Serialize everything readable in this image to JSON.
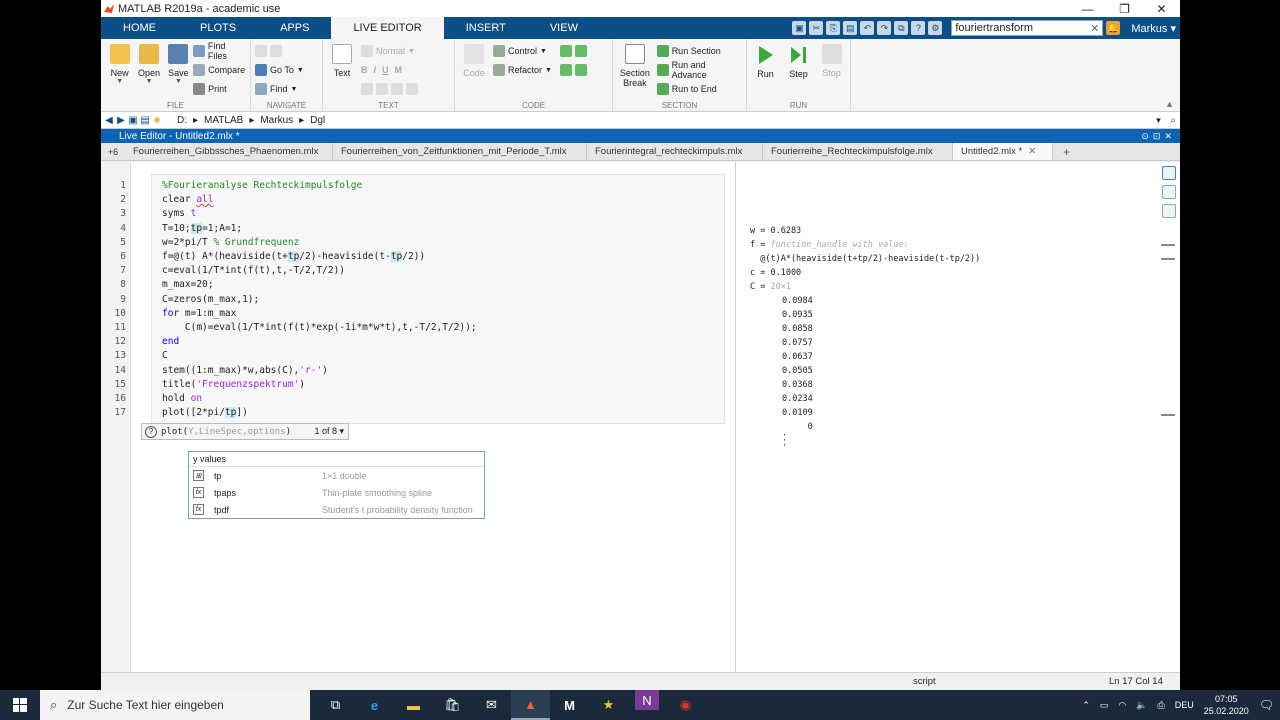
{
  "window": {
    "title": "MATLAB R2019a - academic use",
    "minimize": "—",
    "maximize": "❐",
    "close": "✕"
  },
  "ribbon": {
    "tabs": [
      "HOME",
      "PLOTS",
      "APPS",
      "LIVE EDITOR",
      "INSERT",
      "VIEW"
    ],
    "active_tab": "LIVE EDITOR",
    "search_value": "fouriertransform",
    "user": "Markus ▾"
  },
  "toolstrip": {
    "file": {
      "label": "FILE",
      "new": "New",
      "open": "Open",
      "save": "Save",
      "find_files": "Find Files",
      "compare": "Compare",
      "print": "Print"
    },
    "navigate": {
      "label": "NAVIGATE",
      "goto": "Go To",
      "find": "Find"
    },
    "text": {
      "label": "TEXT",
      "text": "Text",
      "normal": "Normal",
      "bold": "B",
      "italic": "I",
      "underline": "U",
      "mono": "M"
    },
    "code": {
      "label": "CODE",
      "code": "Code",
      "control": "Control",
      "refactor": "Refactor"
    },
    "section": {
      "label": "SECTION",
      "section_break_1": "Section",
      "section_break_2": "Break",
      "run_section": "Run Section",
      "run_and_advance": "Run and Advance",
      "run_to_end": "Run to End"
    },
    "run": {
      "label": "RUN",
      "run": "Run",
      "step": "Step",
      "stop": "Stop"
    }
  },
  "address": {
    "path": [
      "D:",
      "MATLAB",
      "Markus",
      "Dgl"
    ]
  },
  "live_editor": {
    "title": "Live Editor - Untitled2.mlx *"
  },
  "doc_tabs": {
    "first": "+6",
    "tabs": [
      "Fourierreihen_Gibbssches_Phaenomen.mlx",
      "Fourierreihen_von_Zeitfunktionen_mit_Periode_T.mlx",
      "Fourierintegral_rechteckimpuls.mlx",
      "Fourierreihe_Rechteckimpulsfolge.mlx",
      "Untitled2.mlx *"
    ],
    "close_glyph": "✕",
    "plus": "+"
  },
  "code_lines": [
    {
      "n": "1",
      "parts": [
        {
          "t": "%Fourieranalyse Rechteckimpulsfolge",
          "c": "cm"
        }
      ]
    },
    {
      "n": "2",
      "parts": [
        {
          "t": "clear "
        },
        {
          "t": "all",
          "c": "st sq"
        }
      ]
    },
    {
      "n": "3",
      "parts": [
        {
          "t": "syms "
        },
        {
          "t": "t",
          "c": "st"
        }
      ]
    },
    {
      "n": "4",
      "parts": [
        {
          "t": "T=10;"
        },
        {
          "t": "tp",
          "c": "hl"
        },
        {
          "t": "=1;A=1;"
        }
      ]
    },
    {
      "n": "5",
      "parts": [
        {
          "t": "w=2*pi/T "
        },
        {
          "t": "% Grundfrequenz",
          "c": "cm"
        }
      ]
    },
    {
      "n": "6",
      "parts": [
        {
          "t": "f=@(t) A*(heaviside(t+"
        },
        {
          "t": "tp",
          "c": "hl"
        },
        {
          "t": "/2)-heaviside(t-"
        },
        {
          "t": "tp",
          "c": "hl"
        },
        {
          "t": "/2))"
        }
      ]
    },
    {
      "n": "7",
      "parts": [
        {
          "t": "c=eval(1/T*int(f(t),t,-T/2,T/2))"
        }
      ]
    },
    {
      "n": "8",
      "parts": [
        {
          "t": "m_max=20;"
        }
      ]
    },
    {
      "n": "9",
      "parts": [
        {
          "t": "C=zeros(m_max,1);"
        }
      ]
    },
    {
      "n": "10",
      "parts": [
        {
          "t": "for",
          "c": "kw"
        },
        {
          "t": " m=1:m_max"
        }
      ]
    },
    {
      "n": "11",
      "parts": [
        {
          "t": "    C(m)=eval(1/T*int(f(t)*exp(-1i*m*w*t),t,-T/2,T/2));"
        }
      ]
    },
    {
      "n": "12",
      "parts": [
        {
          "t": "end",
          "c": "kw"
        }
      ]
    },
    {
      "n": "13",
      "parts": [
        {
          "t": "C"
        }
      ]
    },
    {
      "n": "14",
      "parts": [
        {
          "t": "stem((1:m_max)*w,abs(C),"
        },
        {
          "t": "'r-'",
          "c": "st"
        },
        {
          "t": ")"
        }
      ]
    },
    {
      "n": "15",
      "parts": [
        {
          "t": "title("
        },
        {
          "t": "'Frequenzspektrum'",
          "c": "st"
        },
        {
          "t": ")"
        }
      ]
    },
    {
      "n": "16",
      "parts": [
        {
          "t": "hold "
        },
        {
          "t": "on",
          "c": "st"
        }
      ]
    },
    {
      "n": "17",
      "parts": [
        {
          "t": "plot([2*pi/"
        },
        {
          "t": "tp",
          "c": "hl"
        },
        {
          "t": "])"
        }
      ]
    }
  ],
  "hint": {
    "icon": "?",
    "fn": "plot(",
    "args": "Y,LineSpec,options",
    "close": ")",
    "count": "1 of 8 ▾"
  },
  "autocomplete": {
    "header": "y values",
    "items": [
      {
        "name": "tp",
        "desc": "1×1 double",
        "icon": "⊞"
      },
      {
        "name": "tpaps",
        "desc": "Thin-plate smoothing spline",
        "icon": "fx"
      },
      {
        "name": "tpdf",
        "desc": "Student's t probability density function",
        "icon": "fx"
      }
    ]
  },
  "output": {
    "w": "w = 0.6283",
    "f_label": "f = ",
    "f_desc": "function_handle with value:",
    "f_value": "  @(t)A*(heaviside(t+tp/2)-heaviside(t-tp/2))",
    "c": "c = 0.1000",
    "C_label": "C = ",
    "C_size": "20×1",
    "C_values": [
      "0.0984",
      "0.0935",
      "0.0858",
      "0.0757",
      "0.0637",
      "0.0505",
      "0.0368",
      "0.0234",
      "0.0109",
      "     0"
    ],
    "ellipsis": [
      "·",
      "·",
      "·"
    ]
  },
  "status": {
    "mode": "script",
    "position": "Ln  17 Col  14"
  },
  "taskbar": {
    "search_placeholder": "Zur Suche Text hier eingeben",
    "lang": "DEU",
    "time": "07:05",
    "date": "25.02.2020"
  },
  "colors": {
    "ribbon_blue": "#0c4f88",
    "editor_header": "#0c64b4",
    "comment": "#228b22",
    "keyword": "#0000ff",
    "string": "#a020f0"
  }
}
